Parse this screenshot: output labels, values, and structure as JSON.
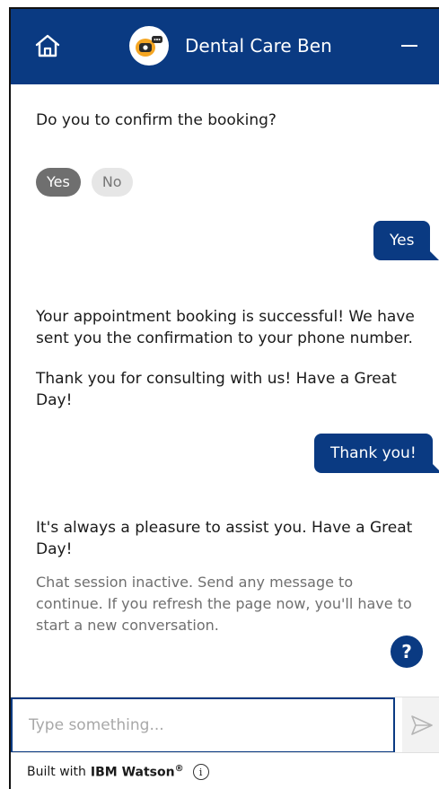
{
  "header": {
    "title": "Dental Care Ben",
    "home_icon": "home-icon",
    "avatar_icon": "bot-avatar-icon",
    "minimize_icon": "minimize-icon",
    "background": "#0a3a82"
  },
  "chat": {
    "messages": [
      {
        "from": "bot",
        "text": "Do you to confirm the booking?"
      },
      {
        "from": "user",
        "text": "Yes"
      },
      {
        "from": "bot",
        "text": "Your appointment booking is successful! We have sent you the confirmation to your phone number."
      },
      {
        "from": "bot",
        "text": "Thank you for consulting with us! Have a Great Day!"
      },
      {
        "from": "user",
        "text": "Thank you!"
      },
      {
        "from": "bot",
        "text": "It's always a pleasure to assist you. Have a Great Day!"
      }
    ],
    "options": [
      {
        "label": "Yes",
        "selected": true
      },
      {
        "label": "No",
        "selected": false
      }
    ],
    "status": "Chat session inactive. Send any message to continue. If you refresh the page now, you'll have to start a new conversation.",
    "help_label": "?"
  },
  "input": {
    "placeholder": "Type something...",
    "value": "",
    "send_icon": "send-icon"
  },
  "footer": {
    "prefix": "Built with",
    "brand": "IBM Watson",
    "trademark": "®",
    "info_label": "i"
  }
}
